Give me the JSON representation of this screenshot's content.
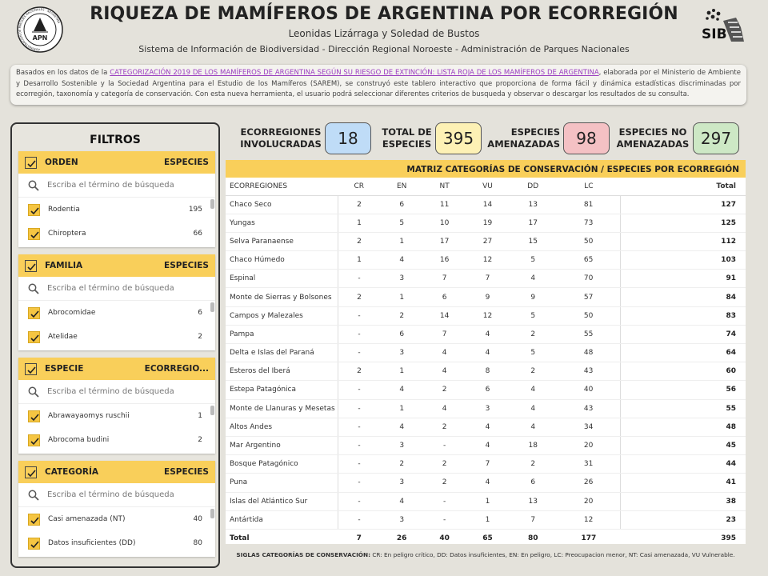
{
  "header": {
    "title": "RIQUEZA DE MAMÍFEROS DE ARGENTINA POR ECORREGIÓN",
    "authors": "Leonidas Lizárraga y Soledad de Bustos",
    "system": "Sistema de Información de Biodiversidad - Dirección Regional Noroeste - Administración de Parques Nacionales",
    "logo_left_text": "APN",
    "logo_left_ring": "ADMINISTRACIÓN DE PARQUES NACIONALES · ARGENTINA",
    "logo_right_text": "SIB"
  },
  "intro": {
    "before": "Basados en los datos de la ",
    "link": "CATEGORIZACIÓN 2019 DE LOS MAMÍFEROS DE ARGENTINA SEGÚN SU RIESGO DE EXTINCIÓN: LISTA ROJA DE LOS MAMÍFEROS DE ARGENTINA",
    "after": ", elaborada por el Ministerio de Ambiente y Desarrollo Sostenible y la Sociedad Argentina para el Estudio de los Mamíferos (SAREM), se construyó este tablero interactivo que proporciona de forma fácil y dinámica estadísticas discriminadas por ecorregión, taxonomía y categoría de conservación. Con esta nueva herramienta, el usuario podrá seleccionar diferentes criterios de busqueda y observar o descargar los resultados de su consulta."
  },
  "filters": {
    "title": "FILTROS",
    "search_placeholder": "Escriba el término de búsqueda",
    "cards": [
      {
        "label": "ORDEN",
        "right": "ESPECIES",
        "items": [
          {
            "label": "Rodentia",
            "count": "195"
          },
          {
            "label": "Chiroptera",
            "count": "66"
          }
        ]
      },
      {
        "label": "FAMILIA",
        "right": "ESPECIES",
        "items": [
          {
            "label": "Abrocomidae",
            "count": "6"
          },
          {
            "label": "Atelidae",
            "count": "2"
          }
        ]
      },
      {
        "label": "ESPECIE",
        "right": "ECORREGIO...",
        "items": [
          {
            "label": "Abrawayaomys ruschii",
            "count": "1"
          },
          {
            "label": "Abrocoma budini",
            "count": "2"
          }
        ]
      },
      {
        "label": "CATEGORÍA",
        "right": "ESPECIES",
        "items": [
          {
            "label": "Casi amenazada (NT)",
            "count": "40"
          },
          {
            "label": "Datos insuficientes (DD)",
            "count": "80"
          }
        ]
      }
    ]
  },
  "kpis": [
    {
      "label1": "ECORREGIONES",
      "label2": "INVOLUCRADAS",
      "value": "18",
      "color": "#bfdcf7"
    },
    {
      "label1": "TOTAL DE",
      "label2": "ESPECIES",
      "value": "395",
      "color": "#fdf1b5"
    },
    {
      "label1": "ESPECIES",
      "label2": "AMENAZADAS",
      "value": "98",
      "color": "#f4c1c4"
    },
    {
      "label1": "ESPECIES NO",
      "label2": "AMENAZADAS",
      "value": "297",
      "color": "#cde8c5"
    }
  ],
  "matrix": {
    "title": "MATRIZ CATEGORÍAS DE CONSERVACIÓN / ESPECIES POR ECORREGIÓN",
    "columns": [
      "ECORREGIONES",
      "CR",
      "EN",
      "NT",
      "VU",
      "DD",
      "LC",
      "Total"
    ],
    "rows": [
      [
        "Chaco Seco",
        "2",
        "6",
        "11",
        "14",
        "13",
        "81",
        "127"
      ],
      [
        "Yungas",
        "1",
        "5",
        "10",
        "19",
        "17",
        "73",
        "125"
      ],
      [
        "Selva Paranaense",
        "2",
        "1",
        "17",
        "27",
        "15",
        "50",
        "112"
      ],
      [
        "Chaco Húmedo",
        "1",
        "4",
        "16",
        "12",
        "5",
        "65",
        "103"
      ],
      [
        "Espinal",
        "-",
        "3",
        "7",
        "7",
        "4",
        "70",
        "91"
      ],
      [
        "Monte de Sierras y Bolsones",
        "2",
        "1",
        "6",
        "9",
        "9",
        "57",
        "84"
      ],
      [
        "Campos y Malezales",
        "-",
        "2",
        "14",
        "12",
        "5",
        "50",
        "83"
      ],
      [
        "Pampa",
        "-",
        "6",
        "7",
        "4",
        "2",
        "55",
        "74"
      ],
      [
        "Delta e Islas del Paraná",
        "-",
        "3",
        "4",
        "4",
        "5",
        "48",
        "64"
      ],
      [
        "Esteros del Iberá",
        "2",
        "1",
        "4",
        "8",
        "2",
        "43",
        "60"
      ],
      [
        "Estepa Patagónica",
        "-",
        "4",
        "2",
        "6",
        "4",
        "40",
        "56"
      ],
      [
        "Monte de Llanuras y Mesetas",
        "-",
        "1",
        "4",
        "3",
        "4",
        "43",
        "55"
      ],
      [
        "Altos Andes",
        "-",
        "4",
        "2",
        "4",
        "4",
        "34",
        "48"
      ],
      [
        "Mar Argentino",
        "-",
        "3",
        "-",
        "4",
        "18",
        "20",
        "45"
      ],
      [
        "Bosque Patagónico",
        "-",
        "2",
        "2",
        "7",
        "2",
        "31",
        "44"
      ],
      [
        "Puna",
        "-",
        "3",
        "2",
        "4",
        "6",
        "26",
        "41"
      ],
      [
        "Islas del Atlántico Sur",
        "-",
        "4",
        "-",
        "1",
        "13",
        "20",
        "38"
      ],
      [
        "Antártida",
        "-",
        "3",
        "-",
        "1",
        "7",
        "12",
        "23"
      ]
    ],
    "total": [
      "Total",
      "7",
      "26",
      "40",
      "65",
      "80",
      "177",
      "395"
    ]
  },
  "footer": {
    "label": "SIGLAS CATEGORÍAS DE CONSERVACIÓN:",
    "text": " CR: En peligro crítico, DD: Datos insuficientes, EN: En peligro, LC: Preocupacion menor, NT: Casi amenazada, VU Vulnerable."
  },
  "colors": {
    "accent_yellow": "#f9cf5a",
    "background": "#e4e2db"
  },
  "icons": {
    "logo_left": "apn-logo",
    "logo_right": "sib-logo",
    "search": "search-icon",
    "checkbox": "checkbox-icon"
  }
}
